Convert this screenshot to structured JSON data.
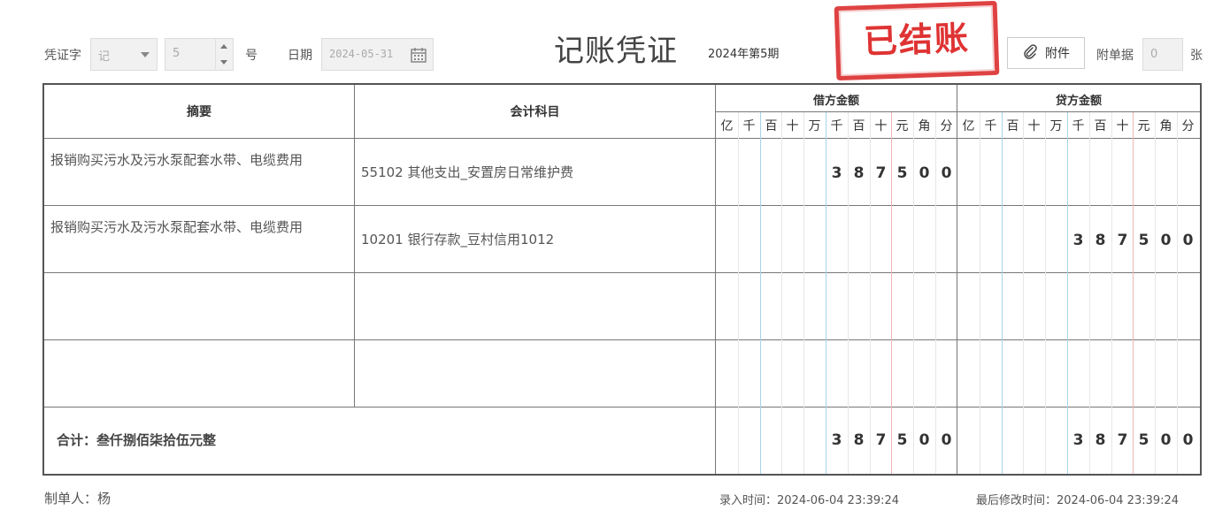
{
  "header": {
    "voucher_word_label": "凭证字",
    "voucher_word_value": "记",
    "voucher_number_value": "5",
    "number_suffix": "号",
    "date_label": "日期",
    "date_value": "2024-05-31",
    "title": "记账凭证",
    "period": "2024年第5期",
    "stamp_text": "已结账",
    "attach_button_label": "附件",
    "attach_count_label": "附单据",
    "attach_count_value": "0",
    "attach_count_suffix": "张"
  },
  "table": {
    "col_summary": "摘要",
    "col_subject": "会计科目",
    "col_debit": "借方金额",
    "col_credit": "贷方金额",
    "units": [
      "亿",
      "千",
      "百",
      "十",
      "万",
      "千",
      "百",
      "十",
      "元",
      "角",
      "分"
    ],
    "rows": [
      {
        "summary": "报销购买污水及污水泵配套水带、电缆费用",
        "subject": "55102 其他支出_安置房日常维护费",
        "debit_digits": [
          "",
          "",
          "",
          "",
          "",
          "3",
          "8",
          "7",
          "5",
          "0",
          "0"
        ],
        "credit_digits": [
          "",
          "",
          "",
          "",
          "",
          "",
          "",
          "",
          "",
          "",
          ""
        ]
      },
      {
        "summary": "报销购买污水及污水泵配套水带、电缆费用",
        "subject": "10201 银行存款_豆村信用1012",
        "debit_digits": [
          "",
          "",
          "",
          "",
          "",
          "",
          "",
          "",
          "",
          "",
          ""
        ],
        "credit_digits": [
          "",
          "",
          "",
          "",
          "",
          "3",
          "8",
          "7",
          "5",
          "0",
          "0"
        ]
      },
      {
        "summary": "",
        "subject": "",
        "debit_digits": [
          "",
          "",
          "",
          "",
          "",
          "",
          "",
          "",
          "",
          "",
          ""
        ],
        "credit_digits": [
          "",
          "",
          "",
          "",
          "",
          "",
          "",
          "",
          "",
          "",
          ""
        ]
      },
      {
        "summary": "",
        "subject": "",
        "debit_digits": [
          "",
          "",
          "",
          "",
          "",
          "",
          "",
          "",
          "",
          "",
          ""
        ],
        "credit_digits": [
          "",
          "",
          "",
          "",
          "",
          "",
          "",
          "",
          "",
          "",
          ""
        ]
      }
    ],
    "total_label": "合计：叁仟捌佰柒拾伍元整",
    "total_debit_digits": [
      "",
      "",
      "",
      "",
      "",
      "3",
      "8",
      "7",
      "5",
      "0",
      "0"
    ],
    "total_credit_digits": [
      "",
      "",
      "",
      "",
      "",
      "3",
      "8",
      "7",
      "5",
      "0",
      "0"
    ]
  },
  "footer": {
    "preparer": "制单人：杨",
    "entry_time": "录入时间：2024-06-04 23:39:24",
    "modified_time": "最后修改时间：2024-06-04 23:39:24"
  },
  "icons": {
    "calendar": "calendar-icon",
    "attach": "paperclip-icon"
  },
  "colors": {
    "stamp": "#d22222",
    "yuan_divider": "#efb4b4",
    "thousand_divider": "#a9d3ea"
  }
}
